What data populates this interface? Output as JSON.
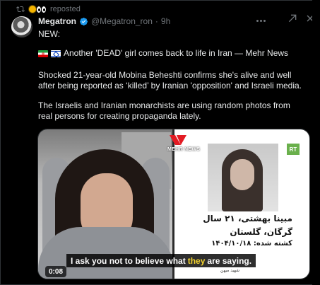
{
  "repost": {
    "label": "reposted",
    "icons": [
      "repost-icon",
      "sun-emoji",
      "eyes-emoji"
    ]
  },
  "post": {
    "author_name": "Megatron",
    "handle": "@Megatron_ron",
    "separator": "·",
    "time": "9h",
    "verified": true,
    "line1": "NEW:",
    "headline": "Another 'DEAD' girl comes back to life in Iran — Mehr News",
    "paragraph1": "Shocked 21-year-old Mobina Beheshti confirms she's alive and well after being reported as ‘killed’ by Iranian 'opposition' and Israeli media.",
    "paragraph2": "The Israelis and Iranian monarchists are using random photos from real persons for creating propaganda lately.",
    "flags": [
      "iran-flag",
      "israel-flag"
    ]
  },
  "media": {
    "subtitle_before": "I ask you not to believe what",
    "subtitle_highlight": "they",
    "subtitle_after": "are saying.",
    "duration": "0:08",
    "mehr_label": "MEHR NEWS",
    "rt_label": "RT",
    "fa_line1": "مبینا بهشتی، ۲۱ سال",
    "fa_line2": "گرگان، گلستان",
    "fa_line3": "کشته شده: ۱۴۰۴/۱۰/۱۸",
    "fa_small": "شهید میهن"
  },
  "colors": {
    "background": "#000000",
    "text": "#e7e9ea",
    "muted": "#71767b",
    "verified": "#1d9bf0",
    "subtitle_highlight": "#f2d22e"
  }
}
